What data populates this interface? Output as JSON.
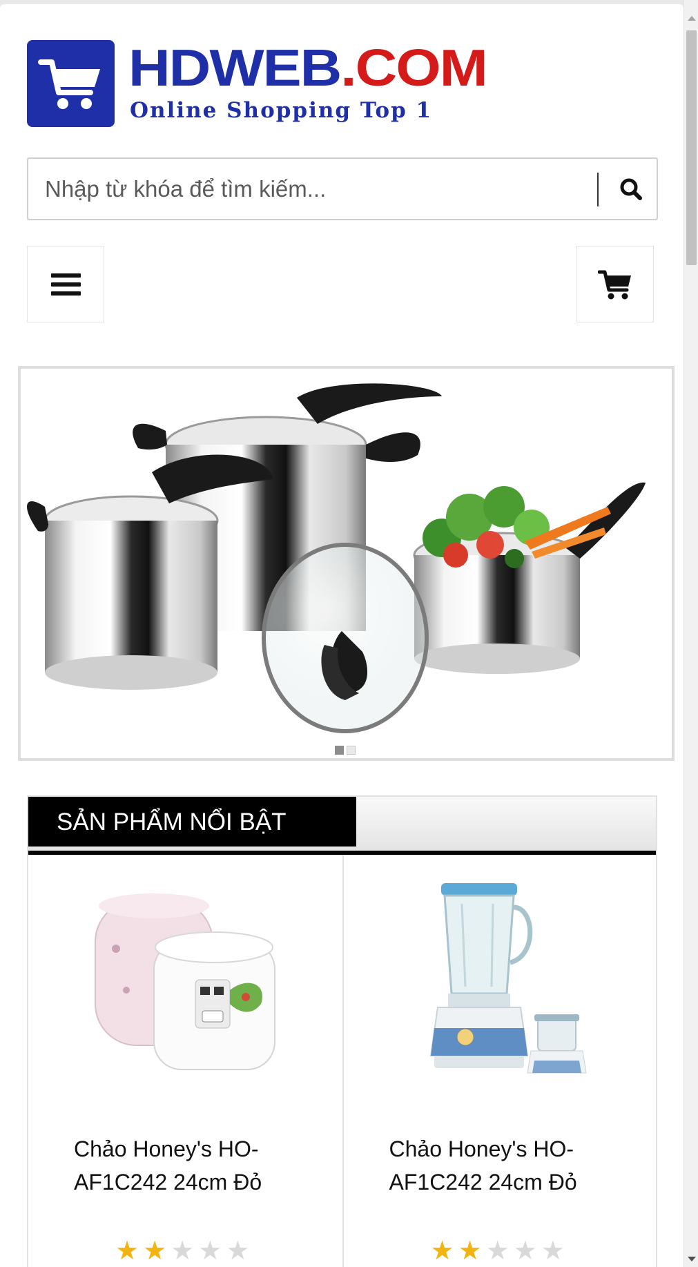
{
  "logo": {
    "word_part1": "HDWEB",
    "word_part2": ".COM",
    "tagline": "Online Shopping Top 1",
    "icon": "shopping-cart-icon",
    "colors": {
      "blue": "#1f2fa8",
      "red": "#d51a1a"
    }
  },
  "search": {
    "placeholder": "Nhập từ khóa để tìm kiếm...",
    "value": "",
    "button_icon": "search-icon"
  },
  "toolbar": {
    "menu_icon": "hamburger-menu-icon",
    "cart_icon": "cart-icon"
  },
  "slider": {
    "image": "stainless-steel-cookware-set",
    "slides": 2,
    "active_slide": 1
  },
  "featured": {
    "title": "SẢN PHẨM NỔI BẬT",
    "products": [
      {
        "name": "Chảo Honey's HO-AF1C242 24cm Đỏ",
        "image": "rice-cooker",
        "rating": 2,
        "max_rating": 5
      },
      {
        "name": "Chảo Honey's HO-AF1C242 24cm Đỏ",
        "image": "blender",
        "rating": 2,
        "max_rating": 5
      }
    ]
  }
}
